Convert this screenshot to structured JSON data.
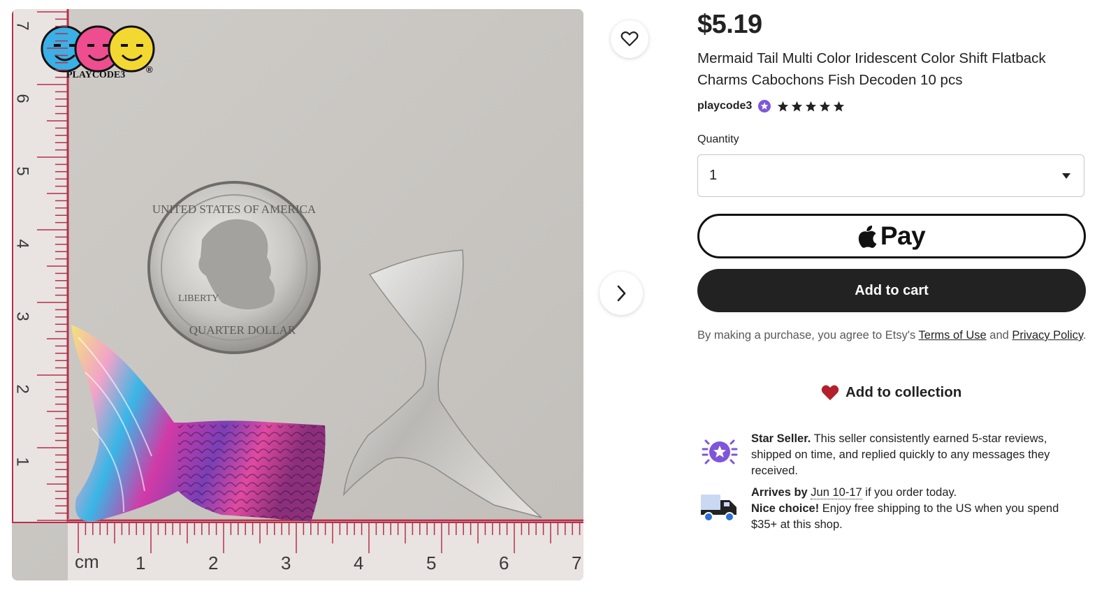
{
  "gallery": {
    "brand_logo": "PLAYCODE3",
    "logo_mark": "®",
    "ruler_unit": "cm",
    "ruler_bottom_numbers": [
      "1",
      "2",
      "3",
      "4",
      "5",
      "6",
      "7"
    ],
    "ruler_left_numbers": [
      "7",
      "6",
      "5",
      "4",
      "3",
      "2",
      "1"
    ],
    "favorite_icon": "heart-outline-icon",
    "next_icon": "chevron-right-icon"
  },
  "product": {
    "price": "$5.19",
    "title": "Mermaid Tail Multi Color Iridescent Color Shift Flatback Charms Cabochons Fish Decoden 10 pcs",
    "seller": "playcode3",
    "seller_badge_icon": "star-seller-badge-icon",
    "rating": 5,
    "rating_max": 5
  },
  "quantity": {
    "label": "Quantity",
    "value": "1",
    "dropdown_icon": "caret-down-icon"
  },
  "buttons": {
    "apple_pay": "Pay",
    "add_to_cart": "Add to cart",
    "add_to_collection": "Add to collection"
  },
  "legal": {
    "prefix": "By making a purchase, you agree to Etsy's ",
    "terms": "Terms of Use",
    "middle": " and ",
    "privacy": "Privacy Policy",
    "suffix": "."
  },
  "star_seller": {
    "title": "Star Seller.",
    "text": " This seller consistently earned 5-star reviews, shipped on time, and replied quickly to any messages they received."
  },
  "shipping": {
    "arrives_prefix": "Arrives by ",
    "arrives_date": "Jun 10-17",
    "arrives_suffix": " if you order today.",
    "nice_title": "Nice choice!",
    "nice_text": " Enjoy free shipping to the US when you spend $35+ at this shop."
  },
  "colors": {
    "star_seller_purple": "#7f56d9",
    "heart_red": "#b3202b",
    "truck_blue": "#2f6fd6",
    "button_dark": "#222222"
  }
}
